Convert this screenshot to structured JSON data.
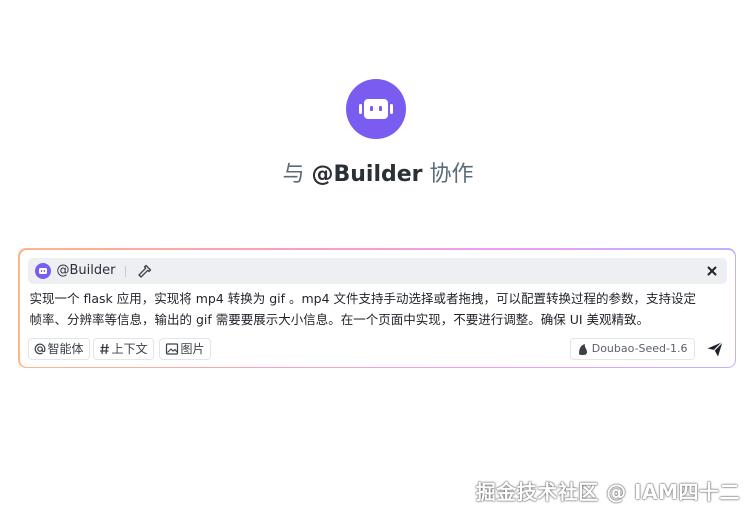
{
  "hero": {
    "heading_prefix": "与",
    "heading_name": "@Builder",
    "heading_suffix": "协作",
    "avatar_icon": "robot-icon",
    "accent_color": "#7a5cf0"
  },
  "input_card": {
    "agent_label": "@Builder",
    "agent_icon": "robot-icon",
    "tools_icon": "hammer-icon",
    "close_icon": "close-icon",
    "prompt_lines": [
      "实现一个 flask 应用，实现将 mp4 转换为 gif 。mp4 文件支持手动选择或者拖拽，可以配置转换过程的参数，支持设定",
      "帧率、分辨率等信息，输出的 gif 需要要展示大小信息。在一个页面中实现，不要进行调整。确保 UI 美观精致。"
    ],
    "chips": [
      {
        "icon": "at-icon",
        "label": "智能体"
      },
      {
        "icon": "hash-icon",
        "label": "上下文"
      },
      {
        "icon": "image-icon",
        "label": "图片"
      }
    ],
    "model_label": "Doubao-Seed-1.6",
    "model_icon": "doubao-icon",
    "send_icon": "send-icon",
    "border_gradient": [
      "#ffb58a",
      "#ff9fb6",
      "#f49cf0",
      "#b8b4ff"
    ]
  },
  "watermark": {
    "text": "掘金技术社区 @ IAM四十二"
  }
}
